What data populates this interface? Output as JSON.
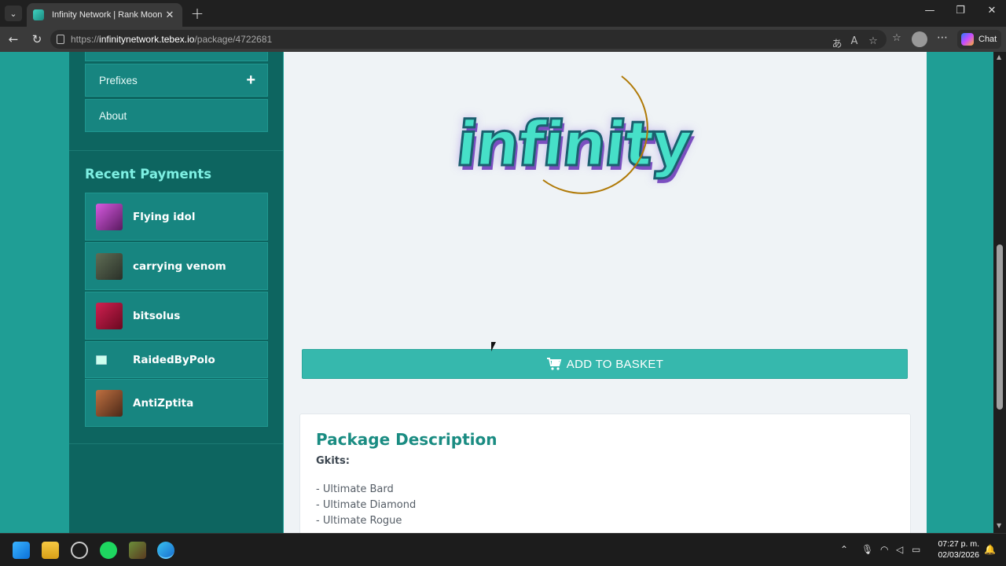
{
  "browser": {
    "tab_title": "Infinity Network | Rank Moon",
    "url_prefix": "https://",
    "url_host": "infinitynetwork.tebex.io",
    "url_path": "/package/4722681",
    "chat_label": "Chat"
  },
  "sidebar": {
    "items": [
      {
        "label": ""
      },
      {
        "label": "Prefixes"
      },
      {
        "label": "About"
      }
    ],
    "recent_title": "Recent Payments",
    "payments": [
      {
        "name": "Flying idol",
        "avatar_color": "#c03fd0"
      },
      {
        "name": "carrying venom",
        "avatar_color": "#3c4a3a"
      },
      {
        "name": "bitsolus",
        "avatar_color": "#b01840"
      },
      {
        "name": "RaidedByPolo",
        "avatar_color": ""
      },
      {
        "name": "AntiZptita",
        "avatar_color": "#a05030"
      }
    ]
  },
  "main": {
    "logo_text": "infinity",
    "add_button": "ADD TO BASKET",
    "description": {
      "title": "Package Description",
      "subtitle": "Gkits:",
      "items": [
        "- Ultimate Bard",
        "- Ultimate Diamond",
        "- Ultimate Rogue"
      ]
    }
  },
  "taskbar": {
    "time": "07:27 p. m.",
    "date": "02/03/2026"
  },
  "colors": {
    "accent": "#36b8ad",
    "sidebar_bg": "#0d6560",
    "page_bg": "#1f9e95",
    "heading": "#1a8c82"
  }
}
